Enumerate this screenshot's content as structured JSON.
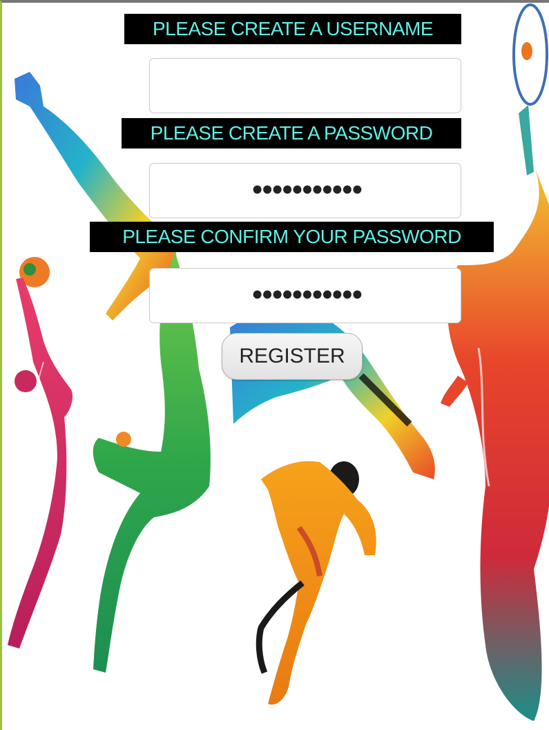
{
  "form": {
    "username_label": "PLEASE CREATE A USERNAME",
    "username_value": "",
    "password_label": "PLEASE CREATE A PASSWORD",
    "password_value": "•••••••••••",
    "confirm_label": "PLEASE CONFIRM YOUR PASSWORD",
    "confirm_value": "•••••••••••",
    "register_label": "REGISTER"
  },
  "theme": {
    "label_text": "#5ff0e6",
    "label_background": "#000000",
    "page_background": "#ffffff"
  },
  "background_art": {
    "icon": "colorful-sports-silhouettes",
    "figures": [
      "tennis-player",
      "volleyball-player",
      "basketball-dunker",
      "soccer-player",
      "sprinter"
    ]
  }
}
